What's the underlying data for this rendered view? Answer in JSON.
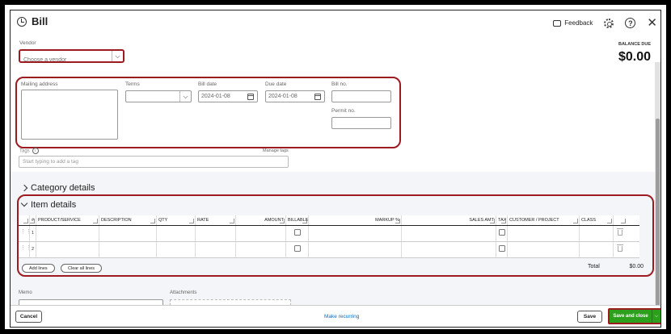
{
  "header": {
    "title": "Bill",
    "feedback_label": "Feedback",
    "balance_label": "BALANCE DUE",
    "balance_value": "$0.00"
  },
  "vendor": {
    "label": "Vendor",
    "placeholder": "Choose a vendor"
  },
  "form": {
    "mailing_label": "Mailing address",
    "terms_label": "Terms",
    "bill_date_label": "Bill date",
    "bill_date_value": "2024-01-08",
    "due_date_label": "Due date",
    "due_date_value": "2024-01-08",
    "bill_no_label": "Bill no.",
    "permit_label": "Permit no."
  },
  "tags": {
    "label": "Tags",
    "manage": "Manage tags",
    "placeholder": "Start typing to add a tag"
  },
  "sections": {
    "category": "Category details",
    "items": "Item details"
  },
  "table": {
    "columns": [
      "#",
      "PRODUCT/SERVICE",
      "DESCRIPTION",
      "QTY",
      "RATE",
      "AMOUNT",
      "BILLABLE",
      "MARKUP %",
      "SALES AMT",
      "TAX",
      "CUSTOMER / PROJECT",
      "CLASS"
    ],
    "rows": [
      {
        "num": "1"
      },
      {
        "num": "2"
      }
    ],
    "add_lines": "Add lines",
    "clear_lines": "Clear all lines",
    "total_label": "Total",
    "total_value": "$0.00"
  },
  "memo": {
    "label": "Memo"
  },
  "attachments": {
    "label": "Attachments"
  },
  "footer": {
    "cancel": "Cancel",
    "recurring": "Make recurring",
    "save": "Save",
    "save_close": "Save and close"
  },
  "colors": {
    "highlight": "#9b1b20",
    "primary_green": "#2ca01c",
    "link_blue": "#0b6bbf"
  }
}
